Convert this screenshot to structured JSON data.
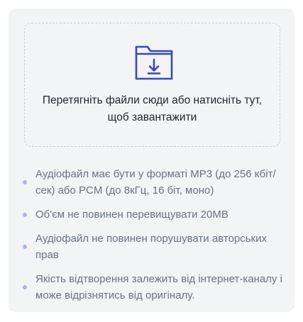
{
  "dropzone": {
    "icon": "download-folder-icon",
    "icon_color": "#3d47b8",
    "text": "Перетягніть файли сюди або натисніть тут, щоб завантажити"
  },
  "rules": [
    {
      "text": "Аудіофайл має бути у форматі MP3 (до 256 кбіт/сек) або PCM (до 8кГц, 16 біт, моно)"
    },
    {
      "text": "Об'єм не повинен перевищувати 20MB"
    },
    {
      "text": "Аудіофайл не повинен порушувати авторських прав"
    },
    {
      "text": "Якість відтворення залежить від інтернет-каналу і може відрізнятись від оригіналу."
    }
  ],
  "colors": {
    "panel_bg": "#f3f4f6",
    "bullet": "#a9b4e9",
    "accent": "#3d47b8"
  }
}
